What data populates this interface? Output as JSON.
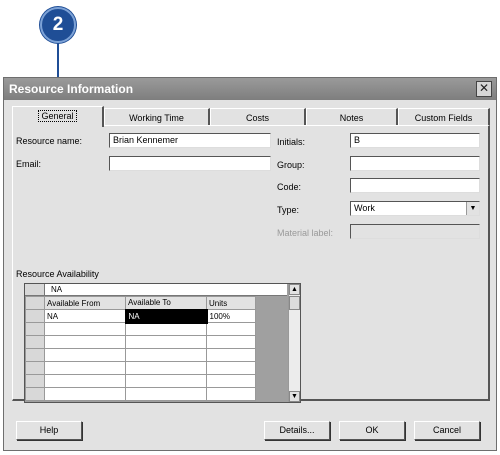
{
  "callout": {
    "number": "2"
  },
  "dialog": {
    "title": "Resource Information",
    "close_symbol": "✕",
    "tabs": [
      {
        "label": "General",
        "active": true
      },
      {
        "label": "Working Time",
        "active": false
      },
      {
        "label": "Costs",
        "active": false
      },
      {
        "label": "Notes",
        "active": false
      },
      {
        "label": "Custom Fields",
        "active": false
      }
    ],
    "fields": {
      "resource_name": {
        "label": "Resource name:",
        "value": "Brian Kennemer"
      },
      "email": {
        "label": "Email:",
        "value": ""
      },
      "initials": {
        "label": "Initials:",
        "value": "B"
      },
      "group": {
        "label": "Group:",
        "value": ""
      },
      "code": {
        "label": "Code:",
        "value": ""
      },
      "type": {
        "label": "Type:",
        "value": "Work"
      },
      "material_label": {
        "label": "Material label:",
        "value": ""
      }
    },
    "availability": {
      "label": "Resource Availability",
      "entry_value": "NA",
      "columns": [
        "Available From",
        "Available To",
        "Units"
      ],
      "rows": [
        [
          "NA",
          "NA",
          "100%"
        ],
        [
          "",
          "",
          ""
        ],
        [
          "",
          "",
          ""
        ],
        [
          "",
          "",
          ""
        ],
        [
          "",
          "",
          ""
        ],
        [
          "",
          "",
          ""
        ],
        [
          "",
          "",
          ""
        ]
      ]
    },
    "buttons": {
      "help": "Help",
      "details": "Details...",
      "ok": "OK",
      "cancel": "Cancel"
    }
  }
}
